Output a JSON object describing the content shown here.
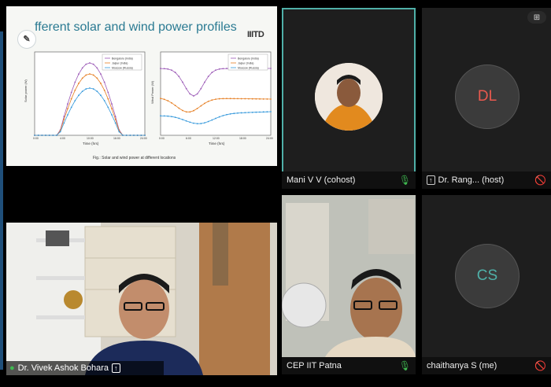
{
  "slide": {
    "title": "fferent solar and wind power profiles",
    "logo_text": "IIITD",
    "caption": "Fig.: Solar and wind power at different locations",
    "solar_chart": {
      "type": "line",
      "ylabel": "Solar power (W)",
      "xlabel": "Time (hrs)",
      "xticks": [
        "0:00",
        "4:00",
        "10:00",
        "16:00",
        "24:00"
      ],
      "legend": [
        "Bengaluru (India)",
        "Jaipur (India)",
        "Moscow (Russia)"
      ]
    },
    "wind_chart": {
      "type": "line",
      "ylabel": "Wind Power (W)",
      "xlabel": "Time (hrs)",
      "xticks": [
        "0:00",
        "6:00",
        "12:00",
        "18:00",
        "24:00"
      ],
      "legend": [
        "Bengaluru (India)",
        "Jaipur (India)",
        "Moscow (Russia)"
      ]
    }
  },
  "speaker": {
    "name": "Dr. Vivek Ashok Bohara"
  },
  "participants": [
    {
      "name": "Mani V V (cohost)",
      "initials": "",
      "mic": "mic-on",
      "color": "#2a2a2a"
    },
    {
      "name": "Dr. Rang... (host)",
      "initials": "DL",
      "mic": "mic-muted",
      "color": "#e8594e"
    },
    {
      "name": "CEP IIT Patna",
      "initials": "",
      "mic": "mic-on",
      "color": "#2a2a2a"
    },
    {
      "name": "chaithanya S (me)",
      "initials": "CS",
      "mic": "mic-muted",
      "color": "#4fb0a8"
    }
  ],
  "colors": {
    "active_border": "#4fb0a8",
    "mic_on": "#3fb950",
    "mic_muted": "#e0473c"
  }
}
